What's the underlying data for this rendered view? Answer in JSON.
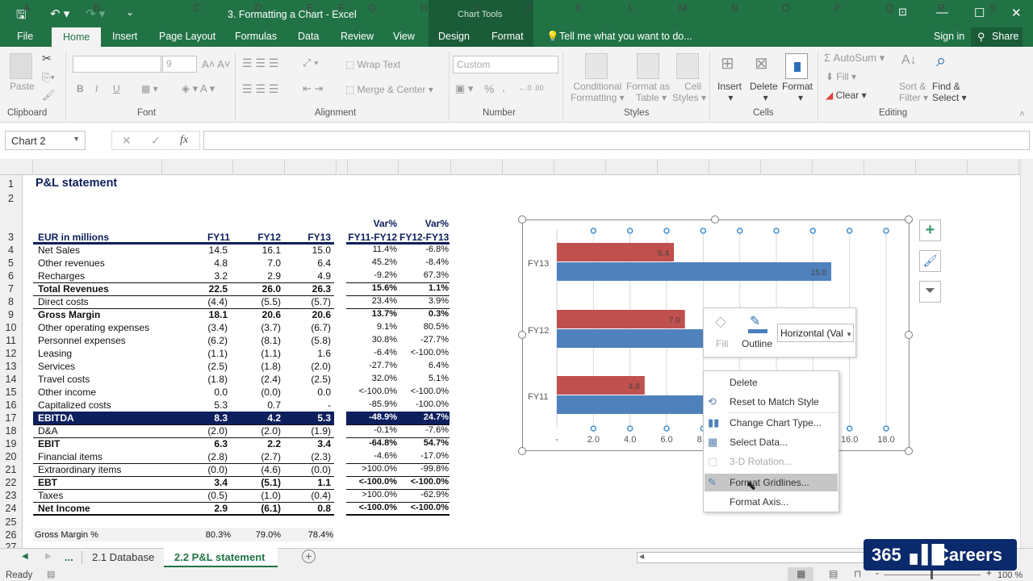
{
  "window": {
    "title": "3. Formatting a Chart - Excel",
    "context_title": "Chart Tools",
    "controls": {
      "ribbon_display": "⊡",
      "minimize": "—",
      "maximize": "☐",
      "close": "✕"
    }
  },
  "qat": {
    "save": "🖫",
    "undo": "↶ ▾",
    "redo": "↷ ▾",
    "customize": "⌄"
  },
  "tabs": [
    "File",
    "Home",
    "Insert",
    "Page Layout",
    "Formulas",
    "Data",
    "Review",
    "View",
    "Design",
    "Format"
  ],
  "tell_me": "Tell me what you want to do...",
  "sign_in": "Sign in",
  "share": "Share",
  "ribbon": {
    "clipboard": {
      "paste": "Paste",
      "group": "Clipboard"
    },
    "font": {
      "size": "9",
      "bold": "B",
      "italic": "I",
      "underline": "U",
      "group": "Font"
    },
    "alignment": {
      "wrap": "Wrap Text",
      "merge": "Merge & Center",
      "group": "Alignment"
    },
    "number": {
      "format": "Custom",
      "percent": "%",
      "comma": ",",
      "group": "Number"
    },
    "styles": {
      "conditional": [
        "Conditional",
        "Formatting ▾"
      ],
      "format_table": [
        "Format as",
        "Table ▾"
      ],
      "cell_styles": [
        "Cell",
        "Styles ▾"
      ],
      "group": "Styles"
    },
    "cells": {
      "insert": "Insert",
      "delete": "Delete",
      "format": "Format",
      "group": "Cells"
    },
    "editing": {
      "autosum": "AutoSum ▾",
      "fill": "Fill ▾",
      "clear": "Clear ▾",
      "sort": [
        "Sort &",
        "Filter ▾"
      ],
      "find": [
        "Find &",
        "Select ▾"
      ],
      "group": "Editing"
    }
  },
  "formula_bar": {
    "name_box": "Chart 2",
    "cancel": "✕",
    "enter": "✓",
    "fx": "fx",
    "value": ""
  },
  "columns": [
    "A",
    "B",
    "C",
    "D",
    "E",
    "F",
    "G",
    "H",
    "I",
    "J",
    "K",
    "L",
    "M",
    "N",
    "O",
    "P",
    "Q",
    "R",
    "S"
  ],
  "sheet": {
    "title": "P&L statement",
    "header": {
      "label": "EUR in millions",
      "fy11": "FY11",
      "fy12": "FY12",
      "fy13": "FY13",
      "var1_top": "Var%",
      "var1": "FY11-FY12",
      "var2_top": "Var%",
      "var2": "FY12-FY13"
    },
    "rows": [
      {
        "n": "4",
        "label": "Net Sales",
        "c": "14.5",
        "d": "16.1",
        "e": "15.0",
        "g": "11.4%",
        "h": "-6.8%",
        "bold": false
      },
      {
        "n": "5",
        "label": "Other revenues",
        "c": "4.8",
        "d": "7.0",
        "e": "6.4",
        "g": "45.2%",
        "h": "-8.4%",
        "bold": false
      },
      {
        "n": "6",
        "label": "Recharges",
        "c": "3.2",
        "d": "2.9",
        "e": "4.9",
        "g": "-9.2%",
        "h": "67.3%",
        "bold": false
      },
      {
        "n": "7",
        "label": "Total Revenues",
        "c": "22.5",
        "d": "26.0",
        "e": "26.3",
        "g": "15.6%",
        "h": "1.1%",
        "bold": true
      },
      {
        "n": "8",
        "label": "Direct costs",
        "c": "(4.4)",
        "d": "(5.5)",
        "e": "(5.7)",
        "g": "23.4%",
        "h": "3.9%",
        "bold": false
      },
      {
        "n": "9",
        "label": "Gross Margin",
        "c": "18.1",
        "d": "20.6",
        "e": "20.6",
        "g": "13.7%",
        "h": "0.3%",
        "bold": true
      },
      {
        "n": "10",
        "label": "Other operating expenses",
        "c": "(3.4)",
        "d": "(3.7)",
        "e": "(6.7)",
        "g": "9.1%",
        "h": "80.5%",
        "bold": false
      },
      {
        "n": "11",
        "label": "Personnel expenses",
        "c": "(6.2)",
        "d": "(8.1)",
        "e": "(5.8)",
        "g": "30.8%",
        "h": "-27.7%",
        "bold": false
      },
      {
        "n": "12",
        "label": "Leasing",
        "c": "(1.1)",
        "d": "(1.1)",
        "e": "1.6",
        "g": "-6.4%",
        "h": "<-100.0%",
        "bold": false
      },
      {
        "n": "13",
        "label": "Services",
        "c": "(2.5)",
        "d": "(1.8)",
        "e": "(2.0)",
        "g": "-27.7%",
        "h": "6.4%",
        "bold": false
      },
      {
        "n": "14",
        "label": "Travel costs",
        "c": "(1.8)",
        "d": "(2.4)",
        "e": "(2.5)",
        "g": "32.0%",
        "h": "5.1%",
        "bold": false
      },
      {
        "n": "15",
        "label": "Other income",
        "c": "0.0",
        "d": "(0.0)",
        "e": "0.0",
        "g": "<-100.0%",
        "h": "<-100.0%",
        "bold": false
      },
      {
        "n": "16",
        "label": "Capitalized costs",
        "c": "5.3",
        "d": "0.7",
        "e": "-",
        "g": "-85.9%",
        "h": "-100.0%",
        "bold": false
      },
      {
        "n": "17",
        "label": "EBITDA",
        "c": "8.3",
        "d": "4.2",
        "e": "5.3",
        "g": "-48.9%",
        "h": "24.7%",
        "bold": true,
        "highlight": true
      },
      {
        "n": "18",
        "label": "D&A",
        "c": "(2.0)",
        "d": "(2.0)",
        "e": "(1.9)",
        "g": "-0.1%",
        "h": "-7.6%",
        "bold": false
      },
      {
        "n": "19",
        "label": "EBIT",
        "c": "6.3",
        "d": "2.2",
        "e": "3.4",
        "g": "-64.8%",
        "h": "54.7%",
        "bold": true
      },
      {
        "n": "20",
        "label": "Financial items",
        "c": "(2.8)",
        "d": "(2.7)",
        "e": "(2.3)",
        "g": "-4.6%",
        "h": "-17.0%",
        "bold": false
      },
      {
        "n": "21",
        "label": "Extraordinary items",
        "c": "(0.0)",
        "d": "(4.6)",
        "e": "(0.0)",
        "g": ">100.0%",
        "h": "-99.8%",
        "bold": false
      },
      {
        "n": "22",
        "label": "EBT",
        "c": "3.4",
        "d": "(5.1)",
        "e": "1.1",
        "g": "<-100.0%",
        "h": "<-100.0%",
        "bold": true
      },
      {
        "n": "23",
        "label": "Taxes",
        "c": "(0.5)",
        "d": "(1.0)",
        "e": "(0.4)",
        "g": ">100.0%",
        "h": "-62.9%",
        "bold": false
      },
      {
        "n": "24",
        "label": "Net Income",
        "c": "2.9",
        "d": "(6.1)",
        "e": "0.8",
        "g": "<-100.0%",
        "h": "<-100.0%",
        "bold": true
      }
    ],
    "row26": {
      "n": "26",
      "label": "Gross Margin %",
      "c": "80.3%",
      "d": "79.0%",
      "e": "78.4%"
    },
    "row_numbers_top": [
      "1",
      "2",
      "3"
    ],
    "row25": "25",
    "row27": "27"
  },
  "chart_data": {
    "type": "bar",
    "orientation": "horizontal",
    "categories": [
      "FY11",
      "FY12",
      "FY13"
    ],
    "series": [
      {
        "name": "Other revenues",
        "color": "#c0504d",
        "values": [
          4.8,
          7.0,
          6.4
        ],
        "labels": [
          "4.8",
          "7.0",
          "6.4"
        ]
      },
      {
        "name": "Net Sales",
        "color": "#4f81bd",
        "values": [
          14.5,
          16.1,
          15.0
        ],
        "labels": [
          "",
          "",
          "15.0"
        ]
      }
    ],
    "xlim": [
      0,
      18
    ],
    "xticks": [
      "-",
      "2.0",
      "4.0",
      "6.0",
      "8.0",
      "10.0",
      "12.0",
      "14.0",
      "16.0",
      "18.0"
    ],
    "grid": true,
    "gridlines_selected": true
  },
  "mini_toolbar": {
    "fill": "Fill",
    "outline": "Outline",
    "selector": "Horizontal (Val"
  },
  "context_menu": [
    {
      "label": "Delete",
      "disabled": false
    },
    {
      "label": "Reset to Match Style",
      "disabled": false
    },
    {
      "label": "Change Chart Type...",
      "disabled": false
    },
    {
      "label": "Select Data...",
      "disabled": false
    },
    {
      "label": "3-D Rotation...",
      "disabled": true
    },
    {
      "label": "Format Gridlines...",
      "disabled": false,
      "hover": true
    },
    {
      "label": "Format Axis...",
      "disabled": false
    }
  ],
  "sheet_tabs": {
    "more": "...",
    "tabs": [
      "2.1 Database",
      "2.2 P&L statement"
    ],
    "active": "2.2 P&L statement",
    "add": "+"
  },
  "status": {
    "ready": "Ready",
    "zoom": "100 %"
  },
  "watermark": {
    "text": "365",
    "brand": "Careers"
  }
}
